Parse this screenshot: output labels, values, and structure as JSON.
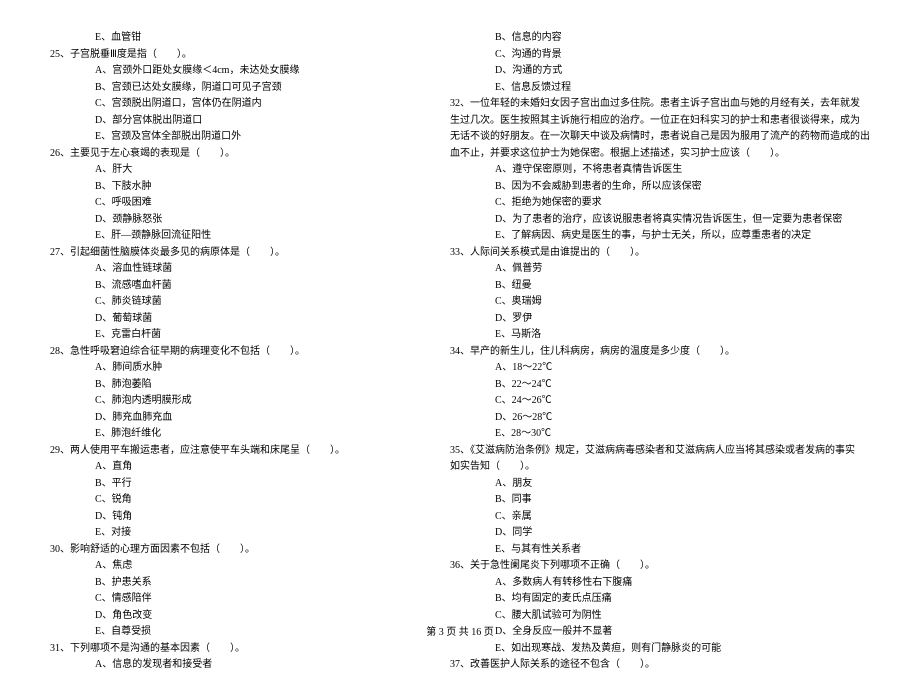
{
  "footer": "第 3 页 共 16 页",
  "left": {
    "pre_option": "E、血管钳",
    "questions": [
      {
        "num": "25、",
        "stem": "子宫脱垂Ⅲ度是指（　　）。",
        "options": [
          "A、宫颈外口距处女膜缘＜4cm，未达处女膜缘",
          "B、宫颈已达处女膜缘，阴道口可见子宫颈",
          "C、宫颈脱出阴道口，宫体仍在阴道内",
          "D、部分宫体脱出阴道口",
          "E、宫颈及宫体全部脱出阴道口外"
        ]
      },
      {
        "num": "26、",
        "stem": "主要见于左心衰竭的表现是（　　）。",
        "options": [
          "A、肝大",
          "B、下肢水肿",
          "C、呼吸困难",
          "D、颈静脉怒张",
          "E、肝—颈静脉回流征阳性"
        ]
      },
      {
        "num": "27、",
        "stem": "引起细菌性脑膜体炎最多见的病原体是（　　）。",
        "options": [
          "A、溶血性链球菌",
          "B、流感嗜血杆菌",
          "C、肺炎链球菌",
          "D、葡萄球菌",
          "E、克雷白杆菌"
        ]
      },
      {
        "num": "28、",
        "stem": "急性呼吸窘迫综合征早期的病理变化不包括（　　）。",
        "options": [
          "A、肺间质水肿",
          "B、肺泡萎陷",
          "C、肺泡内透明膜形成",
          "D、肺充血肺充血",
          "E、肺泡纤维化"
        ]
      },
      {
        "num": "29、",
        "stem": "两人使用平车搬运患者，应注意使平车头端和床尾呈（　　）。",
        "options": [
          "A、直角",
          "B、平行",
          "C、锐角",
          "D、钝角",
          "E、对接"
        ]
      },
      {
        "num": "30、",
        "stem": "影响舒适的心理方面因素不包括（　　）。",
        "options": [
          "A、焦虑",
          "B、护患关系",
          "C、情感陪伴",
          "D、角色改变",
          "E、自尊受损"
        ]
      },
      {
        "num": "31、",
        "stem": "下列哪项不是沟通的基本因素（　　）。",
        "options": [
          "A、信息的发现者和接受者"
        ]
      }
    ]
  },
  "right": {
    "pre_options": [
      "B、信息的内容",
      "C、沟通的背景",
      "D、沟通的方式",
      "E、信息反馈过程"
    ],
    "questions": [
      {
        "num": "32、",
        "stem_lines": [
          "一位年轻的未婚妇女因子宫出血过多住院。患者主诉子宫出血与她的月经有关，去年就发",
          "生过几次。医生按照其主诉施行相应的治疗。一位正在妇科实习的护士和患者很谈得来，成为",
          "无话不谈的好朋友。在一次聊天中谈及病情时，患者说自己是因为服用了流产的药物而造成的出",
          "血不止，并要求这位护士为她保密。根据上述描述，实习护士应该（　　）。"
        ],
        "options": [
          "A、遵守保密原则，不将患者真情告诉医生",
          "B、因为不会威胁到患者的生命，所以应该保密",
          "C、拒绝为她保密的要求",
          "D、为了患者的治疗，应该说服患者将真实情况告诉医生，但一定要为患者保密",
          "E、了解病因、病史是医生的事，与护士无关，所以，应尊重患者的决定"
        ]
      },
      {
        "num": "33、",
        "stem_lines": [
          "人际间关系模式是由谁提出的（　　）。"
        ],
        "options": [
          "A、佩普劳",
          "B、纽曼",
          "C、奥瑞姆",
          "D、罗伊",
          "E、马斯洛"
        ]
      },
      {
        "num": "34、",
        "stem_lines": [
          "早产的新生儿，住儿科病房，病房的温度是多少度（　　）。"
        ],
        "options": [
          "A、18～22℃",
          "B、22～24℃",
          "C、24～26℃",
          "D、26～28℃",
          "E、28～30℃"
        ]
      },
      {
        "num": "35、",
        "stem_lines": [
          "《艾滋病防治条例》规定，艾滋病病毒感染者和艾滋病病人应当将其感染或者发病的事实",
          "如实告知（　　）。"
        ],
        "options": [
          "A、朋友",
          "B、同事",
          "C、亲属",
          "D、同学",
          "E、与其有性关系者"
        ]
      },
      {
        "num": "36、",
        "stem_lines": [
          "关于急性阑尾炎下列哪项不正确（　　）。"
        ],
        "options": [
          "A、多数病人有转移性右下腹痛",
          "B、均有固定的麦氏点压痛",
          "C、腰大肌试验可为阴性",
          "D、全身反应一般并不显著",
          "E、如出现寒战、发热及黄疸，则有门静脉炎的可能"
        ]
      },
      {
        "num": "37、",
        "stem_lines": [
          "改善医护人际关系的途径不包含（　　）。"
        ],
        "options": []
      }
    ]
  }
}
